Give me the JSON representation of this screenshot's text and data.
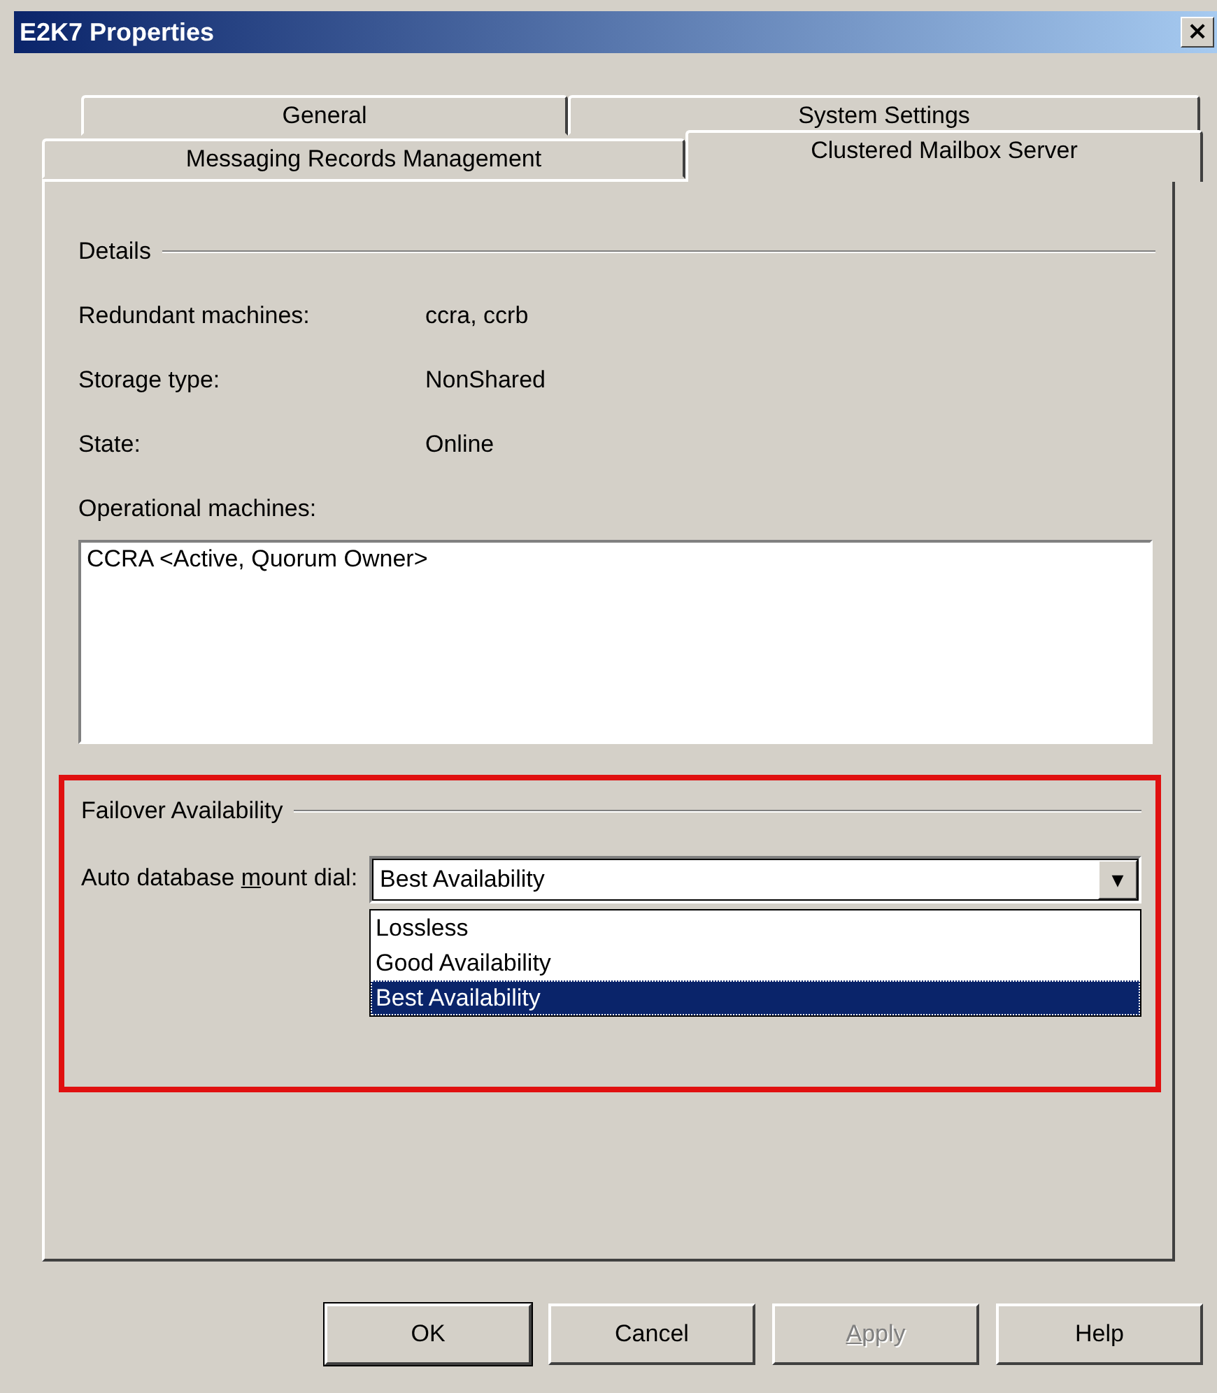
{
  "window": {
    "title": "E2K7 Properties",
    "close": "×"
  },
  "tab_rows": [
    [
      {
        "label": "General",
        "selected": false
      },
      {
        "label": "System Settings",
        "selected": false
      }
    ],
    [
      {
        "label": "Messaging Records Management",
        "selected": false
      },
      {
        "label": "Clustered Mailbox Server",
        "selected": true
      }
    ]
  ],
  "details": {
    "heading": "Details",
    "fields": [
      {
        "label": "Redundant machines:",
        "value": "ccra, ccrb"
      },
      {
        "label": "Storage type:",
        "value": "NonShared"
      },
      {
        "label": "State:",
        "value": "Online"
      }
    ],
    "list_label": "Operational machines:",
    "list_items": [
      "CCRA <Active, Quorum Owner>"
    ]
  },
  "failover": {
    "heading": "Failover Availability",
    "highlighted": true,
    "label": {
      "pre": "Auto database ",
      "key": "m",
      "post": "ount dial:"
    },
    "value": "Best Availability",
    "dropdown_arrow": "▼",
    "expanded": true,
    "options": [
      {
        "label": "Lossless",
        "selected": false
      },
      {
        "label": "Good Availability",
        "selected": false
      },
      {
        "label": "Best Availability",
        "selected": true
      }
    ]
  },
  "buttons": [
    {
      "post": "OK",
      "default": true,
      "disabled": false
    },
    {
      "post": "Cancel",
      "default": false,
      "disabled": false
    },
    {
      "key": "A",
      "post": "pply",
      "default": false,
      "disabled": true
    },
    {
      "post": "Help",
      "default": false,
      "disabled": false
    }
  ]
}
